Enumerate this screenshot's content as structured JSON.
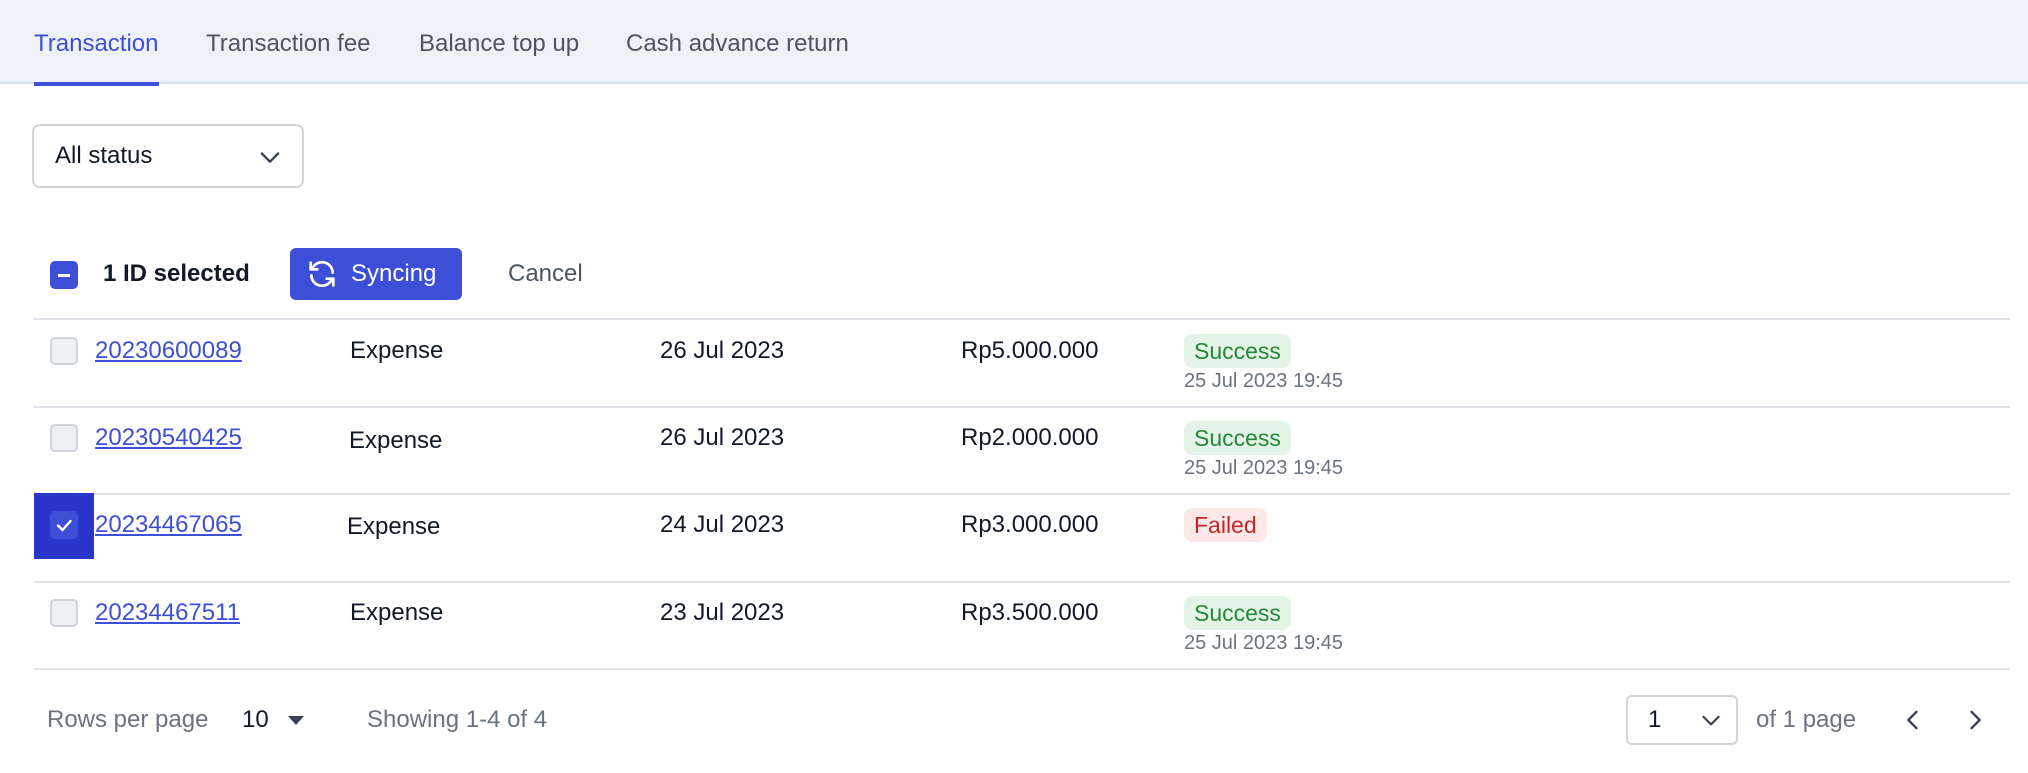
{
  "tabs": {
    "transaction": "Transaction",
    "transaction_fee": "Transaction fee",
    "balance_top_up": "Balance top up",
    "cash_advance_return": "Cash advance return"
  },
  "filter": {
    "status_value": "All status"
  },
  "bulk": {
    "selected_label": "1 ID selected",
    "sync_label": "Syncing",
    "cancel_label": "Cancel"
  },
  "rows": [
    {
      "id": "20230600089",
      "category": "Expense",
      "date": "26 Jul 2023",
      "amount": "Rp5.000.000",
      "status": "Success",
      "status_time": "25 Jul 2023 19:45",
      "checked": false
    },
    {
      "id": "20230540425",
      "category": "Expense",
      "date": "26 Jul 2023",
      "amount": "Rp2.000.000",
      "status": "Success",
      "status_time": "25 Jul 2023 19:45",
      "checked": false
    },
    {
      "id": "20234467065",
      "category": "Expense",
      "date": "24 Jul 2023",
      "amount": "Rp3.000.000",
      "status": "Failed",
      "status_time": "",
      "checked": true
    },
    {
      "id": "20234467511",
      "category": "Expense",
      "date": "23 Jul 2023",
      "amount": "Rp3.500.000",
      "status": "Success",
      "status_time": "25 Jul 2023 19:45",
      "checked": false
    }
  ],
  "pagination": {
    "rows_per_page_label": "Rows per page",
    "rows_per_page_value": "10",
    "showing_text": "Showing 1-4 of 4",
    "current_page": "1",
    "of_pages_text": "of 1 page"
  },
  "colors": {
    "accent": "#3c4fd6",
    "success_text": "#24873a",
    "success_bg": "#e3f4e6",
    "failed_text": "#c2282b",
    "failed_bg": "#fde7e7"
  },
  "icons": {
    "status_select": "chevron-down-icon",
    "sync": "refresh-icon",
    "checkbox_checked": "check-icon",
    "bulk_select": "minus-icon",
    "rows_select": "caret-down-icon",
    "prev": "chevron-left-icon",
    "next": "chevron-right-icon"
  }
}
